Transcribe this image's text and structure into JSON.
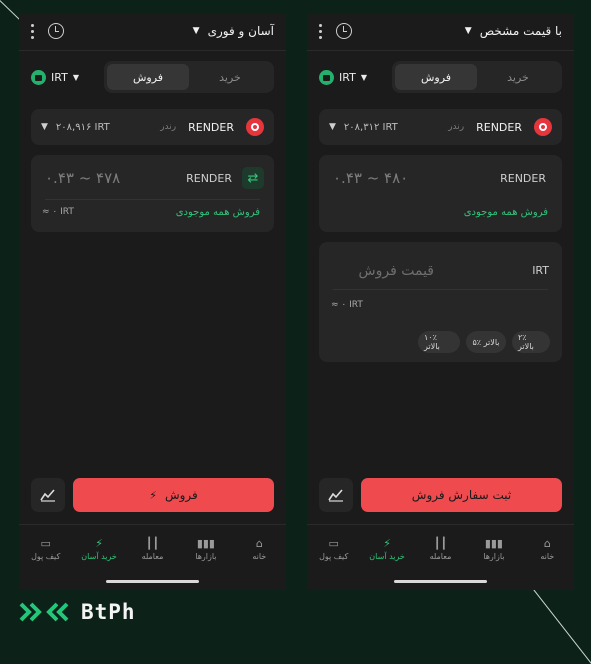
{
  "brand": {
    "logo_text": "BtPh"
  },
  "left": {
    "mode_title": "آسان و فوری",
    "currency": "IRT",
    "tabs": {
      "buy": "خرید",
      "sell": "فروش"
    },
    "asset": {
      "symbol": "RENDER",
      "name_fa": "رندر",
      "balance": "۲۰۸,۹۱۶ IRT"
    },
    "amount": {
      "range": "۰.۴۳ ~ ۴۷۸",
      "unit": "RENDER",
      "approx": "≈ ۰ IRT",
      "sell_all": "فروش همه موجودی"
    },
    "action_label": "فروش"
  },
  "right": {
    "mode_title": "با قیمت مشخص",
    "currency": "IRT",
    "tabs": {
      "buy": "خرید",
      "sell": "فروش"
    },
    "asset": {
      "symbol": "RENDER",
      "name_fa": "رندر",
      "balance": "۲۰۸,۳۱۲ IRT"
    },
    "amount": {
      "range": "۰.۴۳ ~ ۴۸۰",
      "unit": "RENDER",
      "sell_all": "فروش همه موجودی"
    },
    "price": {
      "placeholder": "قیمت فروش",
      "unit": "IRT",
      "approx": "≈ ۰ IRT",
      "chips": [
        "۲٪ بالاتر",
        "۵٪ بالاتر",
        "۱۰٪ بالاتر"
      ]
    },
    "action_label": "ثبت سفارش فروش"
  },
  "nav": {
    "home": "خانه",
    "markets": "بازارها",
    "trade": "معامله",
    "easy_buy": "خرید آسان",
    "wallet": "کیف پول"
  },
  "colors": {
    "background": "#0c2219",
    "accent_green": "#2fc47a",
    "sell_red": "#ef4b4f",
    "card": "#262626"
  }
}
